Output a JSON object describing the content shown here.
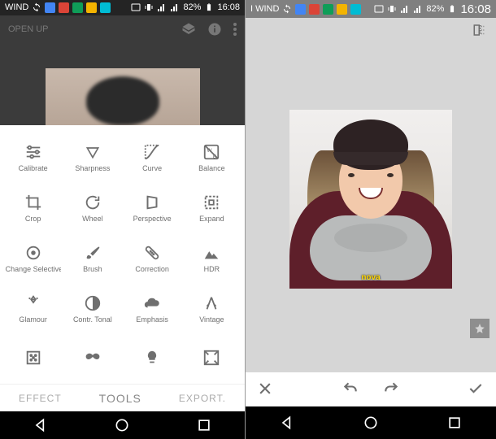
{
  "status": {
    "carrier_left": "WIND",
    "carrier_right": "I WIND",
    "battery": "82%",
    "time": "16:08"
  },
  "left": {
    "header_title": "OPEN UP",
    "tabs": {
      "effect": "EFFECT",
      "tools": "TOOLS",
      "export": "EXPORT."
    },
    "tools": [
      {
        "icon": "sliders",
        "label": "Calibrate"
      },
      {
        "icon": "triangle-down",
        "label": "Sharpness"
      },
      {
        "icon": "curve",
        "label": "Curve"
      },
      {
        "icon": "wb",
        "label": "Balance"
      },
      {
        "icon": "crop",
        "label": "Crop"
      },
      {
        "icon": "rotate",
        "label": "Wheel"
      },
      {
        "icon": "perspective",
        "label": "Perspective"
      },
      {
        "icon": "expand",
        "label": "Expand"
      },
      {
        "icon": "target",
        "label": "Change Selective"
      },
      {
        "icon": "brush",
        "label": "Brush"
      },
      {
        "icon": "bandaid",
        "label": "Correction"
      },
      {
        "icon": "mountains",
        "label": "HDR"
      },
      {
        "icon": "diamond",
        "label": "Glamour"
      },
      {
        "icon": "contrast",
        "label": "Contr. Tonal"
      },
      {
        "icon": "cloud",
        "label": "Emphasis"
      },
      {
        "icon": "vintage",
        "label": "Vintage"
      },
      {
        "icon": "grain",
        "label": ""
      },
      {
        "icon": "mustache",
        "label": ""
      },
      {
        "icon": "lightbulb",
        "label": ""
      },
      {
        "icon": "frame",
        "label": ""
      }
    ]
  },
  "right": {
    "watermark": "nova"
  }
}
